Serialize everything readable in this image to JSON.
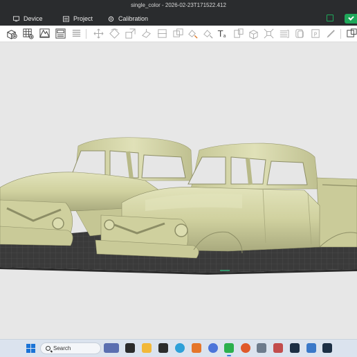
{
  "window": {
    "title": "single_color - 2026-02-23T171522.412"
  },
  "nav": {
    "items": [
      {
        "label": "Device"
      },
      {
        "label": "Project"
      },
      {
        "label": "Calibration"
      }
    ]
  },
  "toolbar": {
    "tools": [
      "add-object-icon",
      "arrange-grid-icon",
      "add-plate-icon",
      "object-list-icon",
      "layers-icon",
      "move-icon",
      "rotate-icon",
      "scale-icon",
      "lay-on-face-icon",
      "cut-icon",
      "boolean-icon",
      "support-paint-icon",
      "seam-paint-icon",
      "text-icon",
      "measure-icon",
      "assembly-icon",
      "split-icon",
      "variable-layer-icon",
      "split-parts-icon",
      "assemble-icon",
      "brim-ears-icon",
      "view-options-icon"
    ]
  },
  "scene": {
    "model_color": "#d6d7a8",
    "plate_color": "#3b3b3b"
  },
  "taskbar": {
    "search_placeholder": "Search",
    "apps": [
      "widgets-icon",
      "task-view-icon",
      "file-explorer-icon",
      "terminal-icon",
      "edge-icon",
      "office-icon",
      "copilot-icon",
      "slicer-app-icon",
      "firefox-icon",
      "calculator-icon",
      "game-icon",
      "photos-icon",
      "settings-icon",
      "store-icon"
    ]
  }
}
